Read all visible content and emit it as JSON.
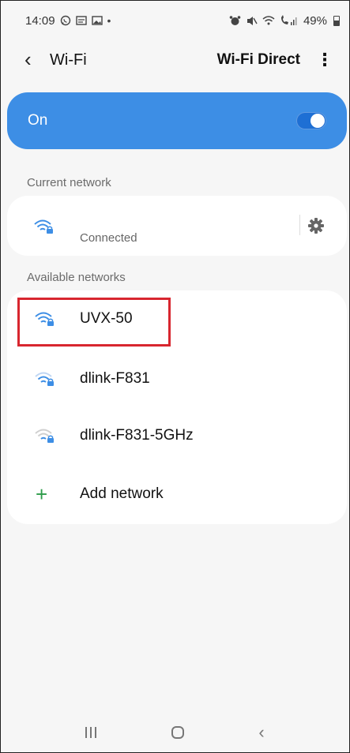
{
  "status_bar": {
    "time": "14:09",
    "left_icons": [
      "whatsapp-icon",
      "message-icon",
      "gallery-icon",
      "dot-icon"
    ],
    "right_icons": [
      "alarm-icon",
      "mute-icon",
      "wifi-icon",
      "call-signal-icon"
    ],
    "battery": "49%"
  },
  "header": {
    "back_glyph": "‹",
    "title": "Wi-Fi",
    "wifi_direct_label": "Wi-Fi Direct",
    "more_glyph": "⋮"
  },
  "toggle_bar": {
    "label": "On",
    "state": "on",
    "color": "#3d8ee5"
  },
  "current_network": {
    "section_label": "Current network",
    "status": "Connected"
  },
  "available_networks": {
    "section_label": "Available networks",
    "items": [
      {
        "name": "UVX-50",
        "icon": "wifi-lock-icon",
        "highlighted": true
      },
      {
        "name": "dlink-F831",
        "icon": "wifi-lock-icon",
        "highlighted": false
      },
      {
        "name": "dlink-F831-5GHz",
        "icon": "wifi-lock-icon",
        "highlighted": false
      }
    ],
    "add_network": {
      "glyph": "+",
      "label": "Add network"
    }
  },
  "nav_bar": {
    "back_glyph": "‹"
  },
  "colors": {
    "accent": "#3d8ee5",
    "highlight": "#d8262f",
    "add_green": "#2d9b4a"
  }
}
